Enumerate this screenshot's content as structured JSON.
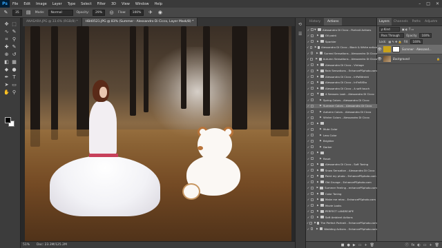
{
  "app": {
    "logo": "Ps"
  },
  "menu": [
    "File",
    "Edit",
    "Image",
    "Layer",
    "Type",
    "Select",
    "Filter",
    "3D",
    "View",
    "Window",
    "Help"
  ],
  "window_controls": [
    "–",
    "□",
    "✕"
  ],
  "options": {
    "brush_size": "35",
    "mode_label": "Mode:",
    "mode_value": "Normal",
    "opacity_label": "Opacity:",
    "opacity_value": "29%",
    "flow_label": "Flow:",
    "flow_value": "100%"
  },
  "doc_tabs": [
    {
      "label": "ANASARA.JPG @ 33.6% (RGB/8) *"
    },
    {
      "label": "HB40521.JPG @ 83% (Summer - Alessandro Di Cicco, Layer Mask/8) *"
    }
  ],
  "status": {
    "zoom": "51%",
    "doc": "Doc: 23.3M/125.2M"
  },
  "actions_panel": {
    "tabs": [
      "History",
      "Actions"
    ],
    "rows": [
      {
        "label": "Alessandro Di Cicco - Portrait Actions",
        "indent": 0,
        "open": true
      },
      {
        "label": "Oil paint",
        "indent": 1
      },
      {
        "label": "Sparkler",
        "indent": 1
      },
      {
        "label": "Alessandro Di Cicco - Black & White action",
        "indent": 1
      },
      {
        "label": "Surreal Sensations - Alessandro Di Cicco",
        "indent": 1
      },
      {
        "label": "Autumn Sensations - Alessandro Di Cicco",
        "indent": 1
      },
      {
        "label": "Alessandro Di Cicco - Vintage",
        "indent": 1
      },
      {
        "label": "Rain Sensations - EnhancePSphoto.com",
        "indent": 1
      },
      {
        "label": "Alessandro Di Cicco - InPaBitmint",
        "indent": 1
      },
      {
        "label": "Alessandro Di Cicco - InFinBiSto",
        "indent": 1
      },
      {
        "label": "Alessandro Di Cicco - A soft touch",
        "indent": 1
      },
      {
        "label": "4 Seasons Look - Alessandro Di Cicco",
        "indent": 1,
        "open": true
      },
      {
        "label": "Spring Colors - Alessandro Di Cicco",
        "indent": 2
      },
      {
        "label": "Summer Colors - Alessandro Di Cicco",
        "indent": 2,
        "highlight": true
      },
      {
        "label": "Autumn Colors - Alessandro Di Cicco",
        "indent": 2
      },
      {
        "label": "Winter Colors - Alessandro Di Cicco",
        "indent": 2
      },
      {
        "label": "",
        "indent": 1
      },
      {
        "label": "Mute Color",
        "indent": 2
      },
      {
        "label": "Less Color",
        "indent": 2
      },
      {
        "label": "Brighter",
        "indent": 2
      },
      {
        "label": "Darker",
        "indent": 2
      },
      {
        "label": "",
        "indent": 1
      },
      {
        "label": "Reset",
        "indent": 2
      },
      {
        "label": "Alessandro Di Cicco - Soft Toning",
        "indent": 1
      },
      {
        "label": "Snow Sensation - Alessandro Di Cicco",
        "indent": 1
      },
      {
        "label": "Paint my photo - EnhancePSphoto.com",
        "indent": 1
      },
      {
        "label": "Old Grunge - EnhancePSphoto.com",
        "indent": 1
      },
      {
        "label": "Summer Feeling - enhancePSphoto.com",
        "indent": 1
      },
      {
        "label": "Color Toning",
        "indent": 1
      },
      {
        "label": "Make me relax - EnhancePSphoto.com",
        "indent": 1
      },
      {
        "label": "Movie Looks",
        "indent": 1
      },
      {
        "label": "PERFECT LANDSCAPE",
        "indent": 1
      },
      {
        "label": "Soft Ambient Actions",
        "indent": 1
      },
      {
        "label": "The Perfect Portrait - EnhancePSphoto.com",
        "indent": 1
      },
      {
        "label": "Wedding Actions - EnhancePSphoto.com",
        "indent": 1
      }
    ],
    "bottom_icons": [
      "■",
      "●",
      "▶",
      "▭",
      "+",
      "🗑"
    ]
  },
  "layers_panel": {
    "tabs": [
      "Layers",
      "Channels",
      "Paths",
      "Adjustm"
    ],
    "kind_label": "ρ Kind",
    "blend_mode": "Pass Through",
    "opacity_label": "Opacity:",
    "opacity_value": "100%",
    "lock_label": "Lock:",
    "fill_label": "Fill:",
    "fill_value": "100%",
    "layers": [
      {
        "name": "Summer - Alessand...",
        "selected": true
      },
      {
        "name": "Background",
        "selected": false
      }
    ],
    "bottom_icons": [
      "ⓕ",
      "fx",
      "◐",
      "▭",
      "+",
      "🗑"
    ]
  },
  "tools": [
    "move",
    "marquee",
    "lasso",
    "quick-select",
    "crop",
    "eyedropper",
    "healing",
    "brush",
    "clone",
    "history-brush",
    "eraser",
    "gradient",
    "blur",
    "dodge",
    "pen",
    "type",
    "path-select",
    "shape",
    "hand",
    "zoom"
  ]
}
